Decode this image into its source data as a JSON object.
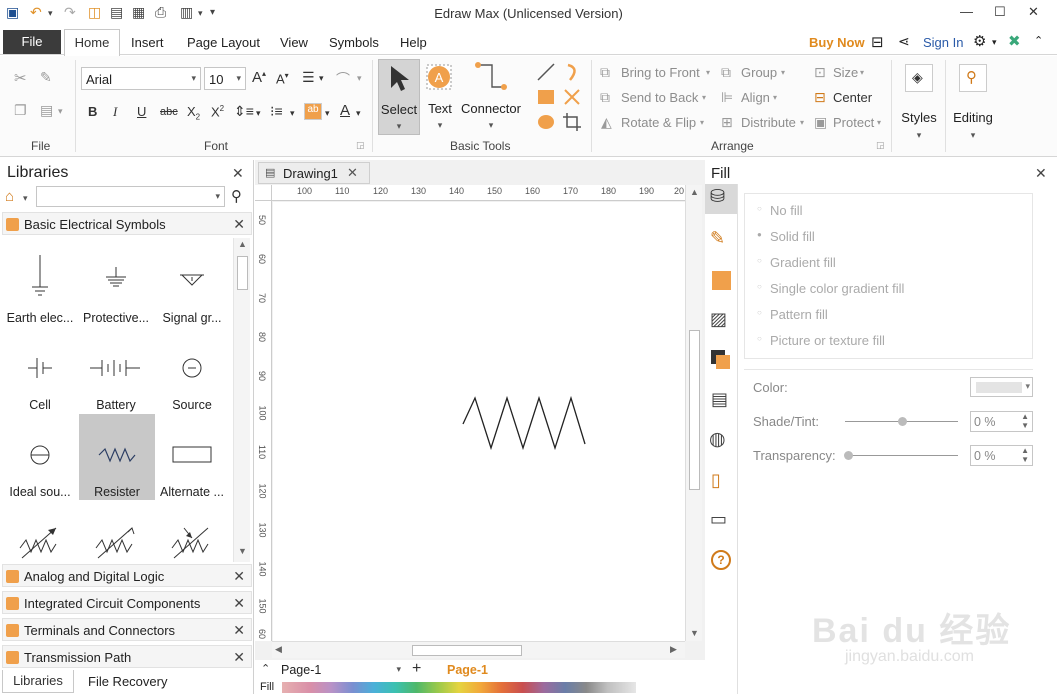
{
  "window": {
    "title": "Edraw Max (Unlicensed Version)"
  },
  "menubar": {
    "file": "File",
    "tabs": [
      "Home",
      "Insert",
      "Page Layout",
      "View",
      "Symbols",
      "Help"
    ],
    "buy_now": "Buy Now",
    "sign_in": "Sign In"
  },
  "ribbon": {
    "groups": {
      "file": "File",
      "font": "Font",
      "basic_tools": "Basic Tools",
      "arrange": "Arrange"
    },
    "font_name": "Arial",
    "font_size": "10",
    "tools": {
      "select": "Select",
      "text": "Text",
      "connector": "Connector"
    },
    "arrange": {
      "bring_to_front": "Bring to Front",
      "send_to_back": "Send to Back",
      "rotate_flip": "Rotate & Flip",
      "group": "Group",
      "align": "Align",
      "distribute": "Distribute",
      "size": "Size",
      "center": "Center",
      "protect": "Protect"
    },
    "styles": "Styles",
    "editing": "Editing"
  },
  "libraries": {
    "title": "Libraries",
    "search_placeholder": "",
    "open_library": "Basic Electrical Symbols",
    "symbols": [
      "Earth elec...",
      "Protective...",
      "Signal gr...",
      "Cell",
      "Battery",
      "Source",
      "Ideal sou...",
      "Resister",
      "Alternate ..."
    ],
    "other_libraries": [
      "Analog and Digital Logic",
      "Integrated Circuit Components",
      "Terminals and Connectors",
      "Transmission Path"
    ],
    "bottom_tabs": [
      "Libraries",
      "File Recovery"
    ]
  },
  "document": {
    "tab": "Drawing1",
    "ruler_h": [
      "100",
      "110",
      "120",
      "130",
      "140",
      "150",
      "160",
      "170",
      "180",
      "190",
      "20"
    ],
    "ruler_v": [
      "50",
      "60",
      "70",
      "80",
      "90",
      "100",
      "110",
      "120",
      "130",
      "140",
      "150",
      "60"
    ],
    "page_selector": "Page-1",
    "active_page": "Page-1",
    "fill_label": "Fill"
  },
  "fill_panel": {
    "title": "Fill",
    "options": [
      "No fill",
      "Solid fill",
      "Gradient fill",
      "Single color gradient fill",
      "Pattern fill",
      "Picture or texture fill"
    ],
    "selected_option": "Solid fill",
    "color_label": "Color:",
    "shade_label": "Shade/Tint:",
    "shade_value": "0 %",
    "transparency_label": "Transparency:",
    "transparency_value": "0 %"
  },
  "colors": {
    "accent": "#f0a04b",
    "file_button": "#3b3b3b",
    "buy_now": "#e08a1e",
    "sign_in": "#2a5aa8"
  },
  "watermark": {
    "text": "Bai du 经验",
    "url": "jingyan.baidu.com"
  }
}
